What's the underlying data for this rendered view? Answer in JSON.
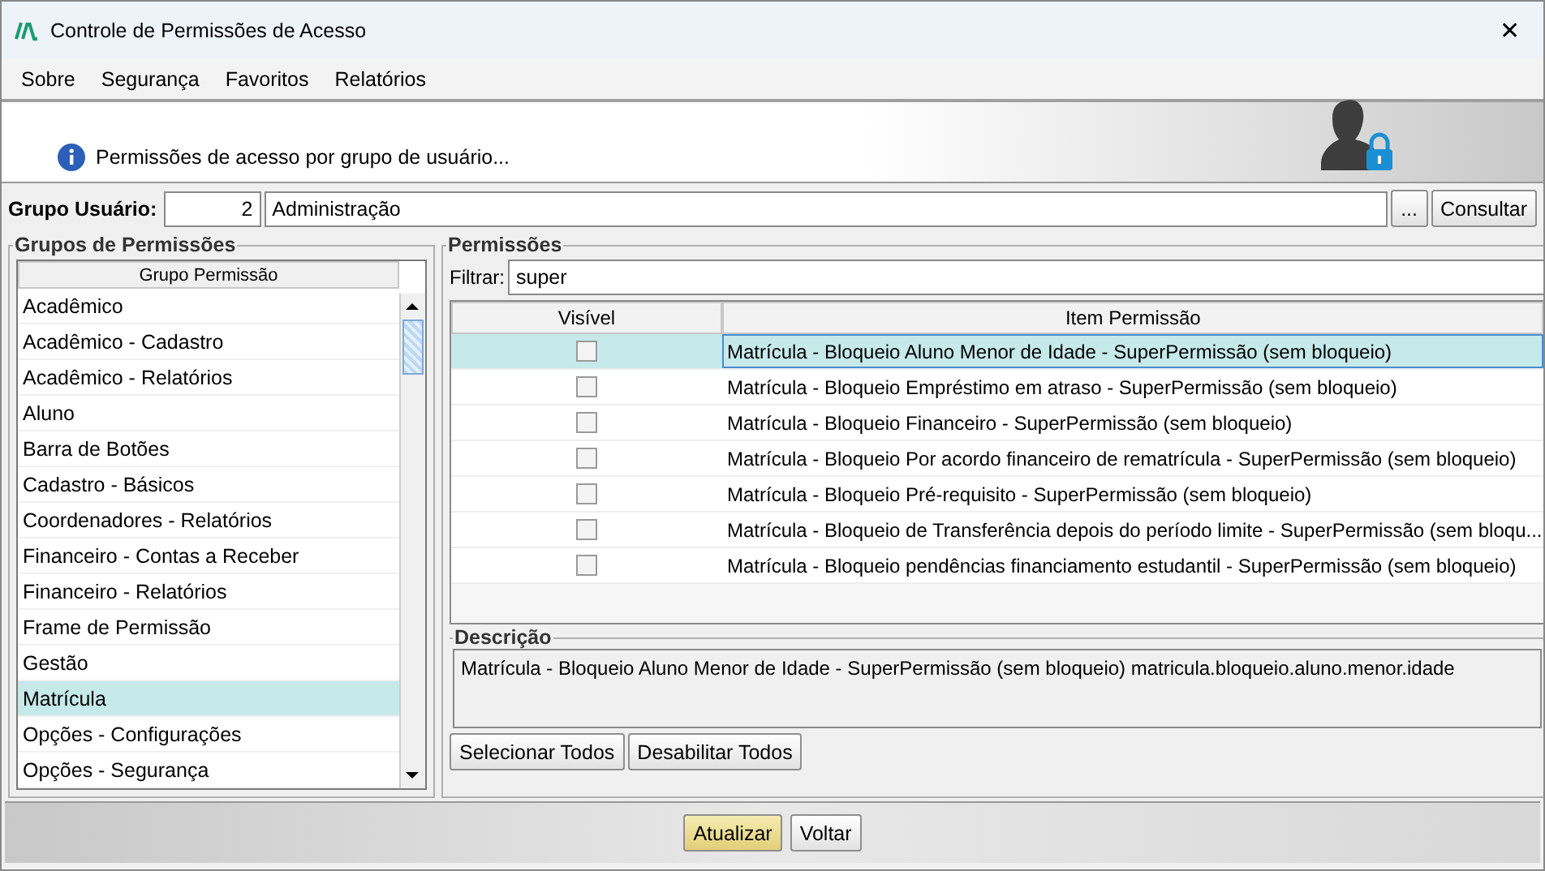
{
  "window": {
    "title": "Controle de Permissões de Acesso",
    "close": "✕"
  },
  "menu": [
    "Sobre",
    "Segurança",
    "Favoritos",
    "Relatórios"
  ],
  "banner": {
    "text": "Permissões de acesso por grupo de usuário..."
  },
  "user_group": {
    "label": "Grupo Usuário:",
    "code": "2",
    "name": "Administração",
    "browse": "...",
    "query": "Consultar"
  },
  "groups": {
    "title": "Grupos de Permissões",
    "column": "Grupo Permissão",
    "items": [
      {
        "label": "Acadêmico",
        "selected": false
      },
      {
        "label": "Acadêmico - Cadastro",
        "selected": false
      },
      {
        "label": "Acadêmico - Relatórios",
        "selected": false
      },
      {
        "label": "Aluno",
        "selected": false
      },
      {
        "label": "Barra de Botões",
        "selected": false
      },
      {
        "label": "Cadastro - Básicos",
        "selected": false
      },
      {
        "label": "Coordenadores - Relatórios",
        "selected": false
      },
      {
        "label": "Financeiro - Contas a Receber",
        "selected": false
      },
      {
        "label": "Financeiro - Relatórios",
        "selected": false
      },
      {
        "label": "Frame de Permissão",
        "selected": false
      },
      {
        "label": "Gestão",
        "selected": false
      },
      {
        "label": "Matrícula",
        "selected": true
      },
      {
        "label": "Opções - Configurações",
        "selected": false
      },
      {
        "label": "Opções - Segurança",
        "selected": false
      }
    ]
  },
  "permissions": {
    "title": "Permissões",
    "filter_label": "Filtrar:",
    "filter": "super",
    "columns": [
      "Visível",
      "Item Permissão"
    ],
    "rows": [
      {
        "item": "Matrícula - Bloqueio Aluno Menor de Idade - SuperPermissão (sem bloqueio)",
        "visible": false,
        "selected": true
      },
      {
        "item": "Matrícula - Bloqueio Empréstimo em atraso - SuperPermissão (sem bloqueio)",
        "visible": false,
        "selected": false
      },
      {
        "item": "Matrícula - Bloqueio Financeiro - SuperPermissão (sem bloqueio)",
        "visible": false,
        "selected": false
      },
      {
        "item": "Matrícula - Bloqueio Por acordo financeiro de rematrícula - SuperPermissão (sem bloqueio)",
        "visible": false,
        "selected": false
      },
      {
        "item": "Matrícula - Bloqueio Pré-requisito - SuperPermissão (sem bloqueio)",
        "visible": false,
        "selected": false
      },
      {
        "item": "Matrícula - Bloqueio de Transferência depois do período limite - SuperPermissão (sem bloqu...",
        "visible": false,
        "selected": false
      },
      {
        "item": "Matrícula - Bloqueio pendências financiamento estudantil - SuperPermissão (sem bloqueio)",
        "visible": false,
        "selected": false
      }
    ]
  },
  "description": {
    "title": "Descrição",
    "text": "Matrícula - Bloqueio Aluno Menor de Idade - SuperPermissão (sem bloqueio) matricula.bloqueio.aluno.menor.idade"
  },
  "buttons": {
    "select_all": "Selecionar Todos",
    "disable_all": "Desabilitar Todos",
    "update": "Atualizar",
    "back": "Voltar"
  }
}
